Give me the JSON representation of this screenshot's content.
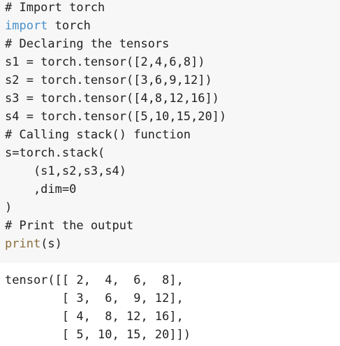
{
  "colors": {
    "code_background": "#f7f7f7",
    "output_background": "#ffffff",
    "text": "#222222",
    "keyword": "#4a90c8",
    "builtin": "#8a6d3b"
  },
  "code": {
    "comment_import": "# Import torch",
    "import_kw": "import",
    "import_rest": " torch",
    "comment_declare": "# Declaring the tensors",
    "s1": "s1 = torch.tensor([2,4,6,8])",
    "s2": "s2 = torch.tensor([3,6,9,12])",
    "s3": "s3 = torch.tensor([4,8,12,16])",
    "s4": "s4 = torch.tensor([5,10,15,20])",
    "comment_stack": "# Calling stack() function",
    "stack_open": "s=torch.stack(",
    "stack_args": "    (s1,s2,s3,s4)",
    "stack_dim": "    ,dim=0",
    "stack_close": ")",
    "comment_print": "# Print the output",
    "print_fn": "print",
    "print_args": "(s)"
  },
  "output": {
    "row1": "tensor([[ 2,  4,  6,  8],",
    "row2": "        [ 3,  6,  9, 12],",
    "row3": "        [ 4,  8, 12, 16],",
    "row4": "        [ 5, 10, 15, 20]])"
  }
}
